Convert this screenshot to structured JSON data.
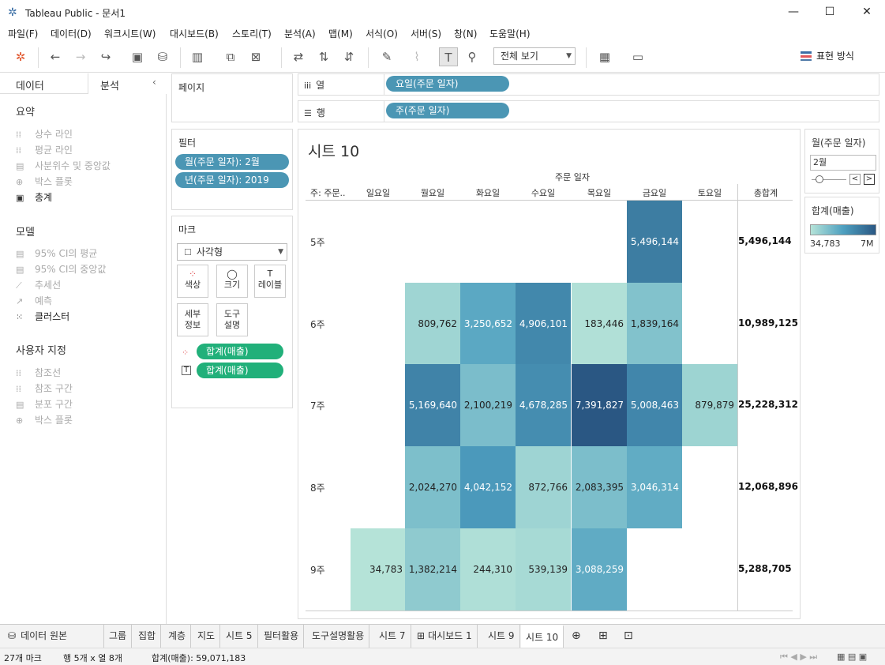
{
  "window": {
    "title": "Tableau Public - 문서1"
  },
  "menu": [
    "파일(F)",
    "데이터(D)",
    "워크시트(W)",
    "대시보드(B)",
    "스토리(T)",
    "분석(A)",
    "맵(M)",
    "서식(O)",
    "서버(S)",
    "창(N)",
    "도움말(H)"
  ],
  "toolbar": {
    "view_select": "전체 보기",
    "show_me": "표현 방식"
  },
  "left_tabs": {
    "data": "데이터",
    "analytics": "분석"
  },
  "analytics": {
    "summary_title": "요약",
    "summary_items": [
      "상수 라인",
      "평균 라인",
      "사분위수 및 중앙값",
      "박스 플롯",
      "총계"
    ],
    "model_title": "모델",
    "model_items": [
      "95% CI의 평균",
      "95% CI의 중앙값",
      "추세선",
      "예측",
      "클러스터"
    ],
    "custom_title": "사용자 지정",
    "custom_items": [
      "참조선",
      "참조 구간",
      "분포 구간",
      "박스 플롯"
    ]
  },
  "pages": {
    "title": "페이지"
  },
  "filters": {
    "title": "필터",
    "items": [
      "월(주문 일자): 2월",
      "년(주문 일자): 2019"
    ]
  },
  "marks": {
    "title": "마크",
    "type": "사각형",
    "buttons": [
      "색상",
      "크기",
      "레이블",
      "세부 정보",
      "도구 설명"
    ],
    "pills": [
      "합계(매출)",
      "합계(매출)"
    ]
  },
  "shelves": {
    "columns_label": "열",
    "rows_label": "행",
    "columns_pill": "요일(주문 일자)",
    "rows_pill": "주(주문 일자)"
  },
  "sheet": {
    "title": "시트 10",
    "top_header": "주문 일자",
    "row_header": "주: 주문..",
    "columns": [
      "일요일",
      "월요일",
      "화요일",
      "수요일",
      "목요일",
      "금요일",
      "토요일",
      "총합계"
    ],
    "rows": [
      {
        "label": "5주",
        "values": [
          "",
          "",
          "",
          "",
          "",
          "5,496,144",
          ""
        ],
        "total": "5,496,144"
      },
      {
        "label": "6주",
        "values": [
          "",
          "809,762",
          "3,250,652",
          "4,906,101",
          "183,446",
          "1,839,164",
          ""
        ],
        "total": "10,989,125"
      },
      {
        "label": "7주",
        "values": [
          "",
          "5,169,640",
          "2,100,219",
          "4,678,285",
          "7,391,827",
          "5,008,463",
          "879,879"
        ],
        "total": "25,228,312"
      },
      {
        "label": "8주",
        "values": [
          "",
          "2,024,270",
          "4,042,152",
          "872,766",
          "2,083,395",
          "3,046,314",
          ""
        ],
        "total": "12,068,896"
      },
      {
        "label": "9주",
        "values": [
          "34,783",
          "1,382,214",
          "244,310",
          "539,139",
          "3,088,259",
          "",
          ""
        ],
        "total": "5,288,705"
      }
    ]
  },
  "month_filter": {
    "title": "월(주문 일자)",
    "value": "2월"
  },
  "legend": {
    "title": "합계(매출)",
    "min": "34,783",
    "max": "7M",
    "color_min": "#b5e3d8",
    "color_max": "#2a5783"
  },
  "bottom_tabs": [
    "데이터 원본",
    "그룹",
    "집합",
    "계층",
    "지도",
    "시트 5",
    "필터활용",
    "도구설명활용",
    "시트 7",
    "대시보드 1",
    "시트 9",
    "시트 10"
  ],
  "status": {
    "marks": "27개 마크",
    "rows_cols": "행 5개  x  열 8개",
    "sum": "합계(매출): 59,071,183"
  }
}
